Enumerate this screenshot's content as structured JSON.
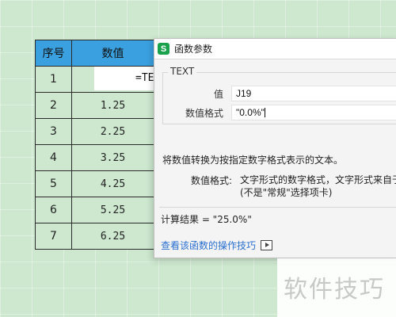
{
  "sheet": {
    "headers": [
      "序号",
      "数值"
    ],
    "rows": [
      {
        "idx": "1",
        "value": ""
      },
      {
        "idx": "2",
        "value": "1.25"
      },
      {
        "idx": "3",
        "value": "2.25"
      },
      {
        "idx": "4",
        "value": "3.25"
      },
      {
        "idx": "5",
        "value": "4.25"
      },
      {
        "idx": "6",
        "value": "5.25"
      },
      {
        "idx": "7",
        "value": "6.25"
      }
    ],
    "active_cell_text": "=TE",
    "header_color": "#3aa0e0",
    "background_color": "#cde8cf"
  },
  "dialog": {
    "icon_letter": "S",
    "title": "函数参数",
    "function_name": "TEXT",
    "args": [
      {
        "label": "值",
        "value": "J19"
      },
      {
        "label": "数值格式",
        "value": "\"0.0%\""
      }
    ],
    "description": "将数值转换为按指定数字格式表示的文本。",
    "param_name": "数值格式:",
    "param_desc_line1": "文字形式的数字格式，文字形式来自于",
    "param_desc_line2": "(不是\"常规\"选择项卡)",
    "result": "计算结果 = \"25.0%\"",
    "help_link": "查看该函数的操作技巧",
    "help_icon": "video-play-icon"
  },
  "watermark": "软件技巧"
}
